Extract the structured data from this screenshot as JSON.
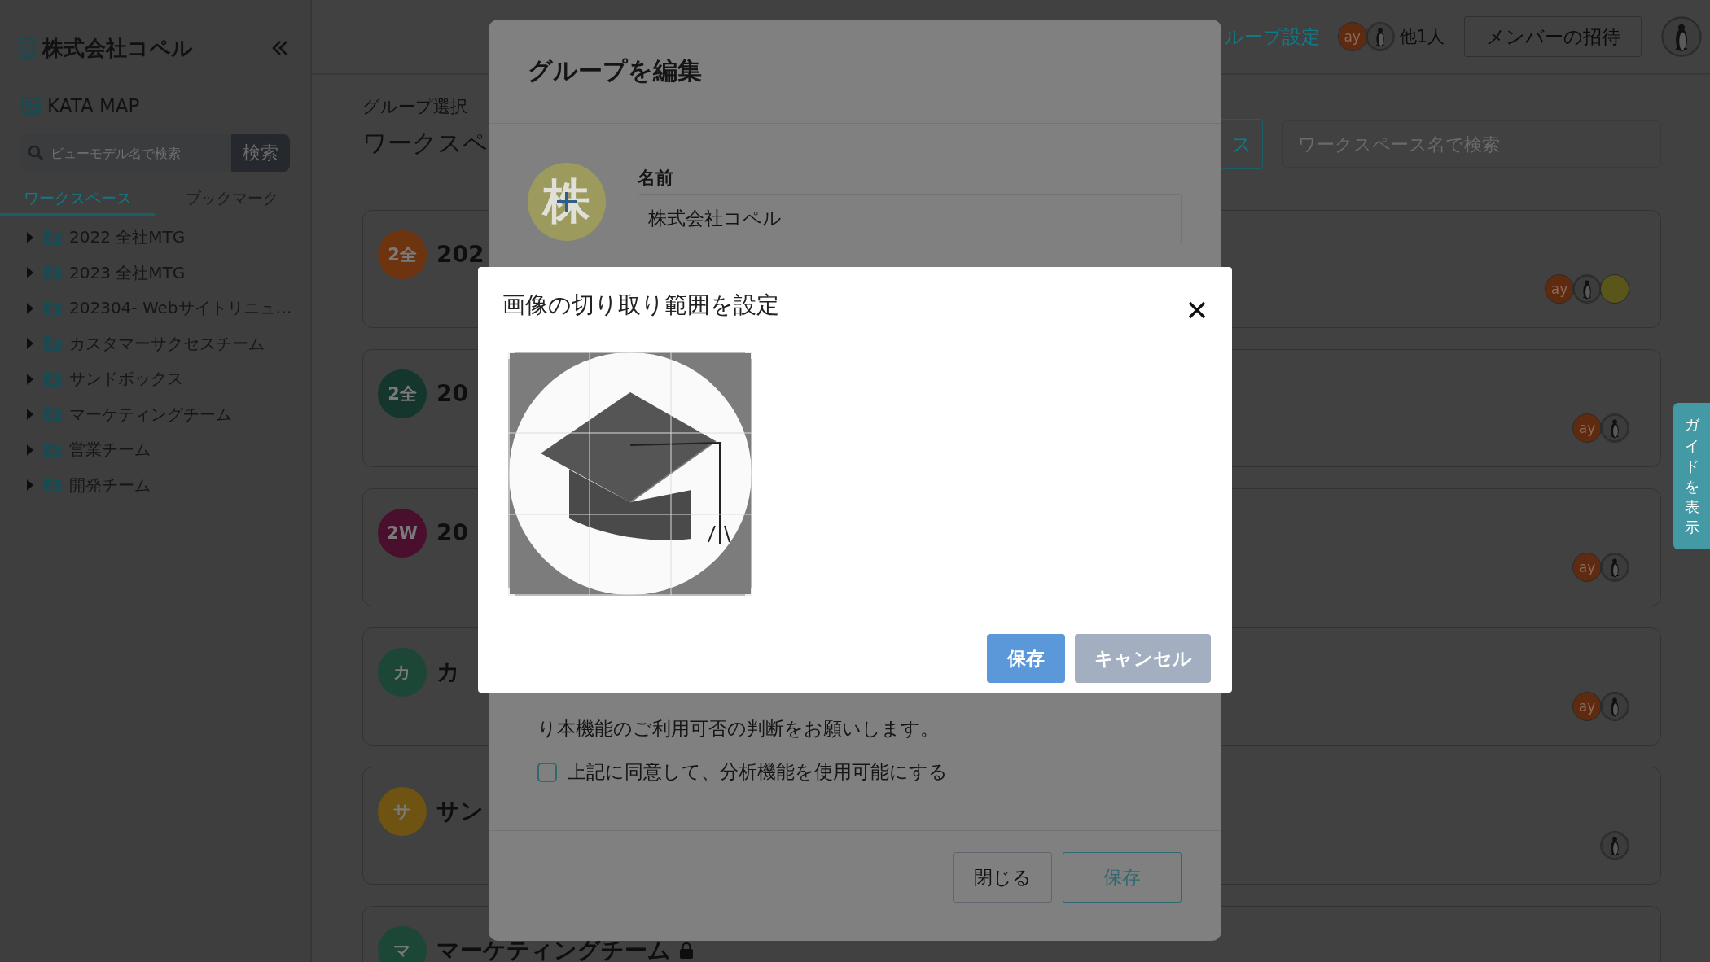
{
  "sidebar": {
    "org_name": "株式会社コペル",
    "app_name": "KATA MAP",
    "search": {
      "placeholder": "ビューモデル名で検索",
      "button": "検索"
    },
    "tabs": [
      {
        "label": "ワークスペース",
        "selected": true
      },
      {
        "label": "ブックマーク",
        "selected": false
      }
    ],
    "tree": [
      {
        "label": "2022 全社MTG",
        "expanded": false
      },
      {
        "label": "2023 全社MTG",
        "expanded": false
      },
      {
        "label": "202304- Webサイトリニュ…",
        "expanded": false
      },
      {
        "label": "カスタマーサクセスチーム",
        "expanded": false
      },
      {
        "label": "サンドボックス",
        "expanded": false
      },
      {
        "label": "マーケティングチーム",
        "expanded": false
      },
      {
        "label": "営業チーム",
        "expanded": false
      },
      {
        "label": "開発チーム",
        "expanded": false
      }
    ]
  },
  "header": {
    "group_settings_link": "ループ設定",
    "members": [
      {
        "kind": "initials",
        "text": "ay",
        "color": "#5e2a10"
      },
      {
        "kind": "photo"
      }
    ],
    "member_count": "他1人",
    "invite_button": "メンバーの招待"
  },
  "main": {
    "breadcrumb": "グループ選択",
    "heading": "ワークスペ",
    "new_button": "ス",
    "search": {
      "placeholder": "ワークスペース名で検索"
    },
    "workspaces": [
      {
        "badge": "2全",
        "color": "#6e3410",
        "title": "202",
        "members": [
          {
            "kind": "initials",
            "text": "ay",
            "color": "#5e2a10"
          },
          {
            "kind": "photo"
          },
          {
            "kind": "blank",
            "color": "#5a5518"
          }
        ]
      },
      {
        "badge": "2全",
        "color": "#14362c",
        "title": "20",
        "members": [
          {
            "kind": "initials",
            "text": "ay",
            "color": "#5e2a10"
          },
          {
            "kind": "photo"
          }
        ]
      },
      {
        "badge": "2W",
        "color": "#4a0f2c",
        "title": "20",
        "members": [
          {
            "kind": "initials",
            "text": "ay",
            "color": "#5e2a10"
          },
          {
            "kind": "photo"
          }
        ]
      },
      {
        "badge": "カ",
        "color": "#1c4636",
        "title": "カ",
        "members": [
          {
            "kind": "initials",
            "text": "ay",
            "color": "#5e2a10"
          },
          {
            "kind": "photo"
          }
        ]
      },
      {
        "badge": "サ",
        "color": "#6e5312",
        "title": "サン",
        "members": [
          {
            "kind": "photo"
          }
        ]
      },
      {
        "badge": "マ",
        "color": "#1c4636",
        "title": "マーケティングチーム",
        "locked": true
      }
    ]
  },
  "guide_tab": "ガイドを表示",
  "edit_group_dialog": {
    "title": "グループを編集",
    "avatar_initial": "株",
    "name_label": "名前",
    "name_value": "株式会社コペル",
    "notice": "り本機能のご利用可否の判断をお願いします。",
    "agree": {
      "label": "上記に同意して、分析機能を使用可能にする",
      "checked": false
    },
    "buttons": [
      {
        "kind": "secondary",
        "label": "閉じる"
      },
      {
        "kind": "primary",
        "label": "保存"
      }
    ]
  },
  "crop_dialog": {
    "title": "画像の切り取り範囲を設定",
    "buttons": [
      {
        "kind": "primary",
        "label": "保存"
      },
      {
        "kind": "secondary",
        "label": "キャンセル"
      }
    ]
  }
}
